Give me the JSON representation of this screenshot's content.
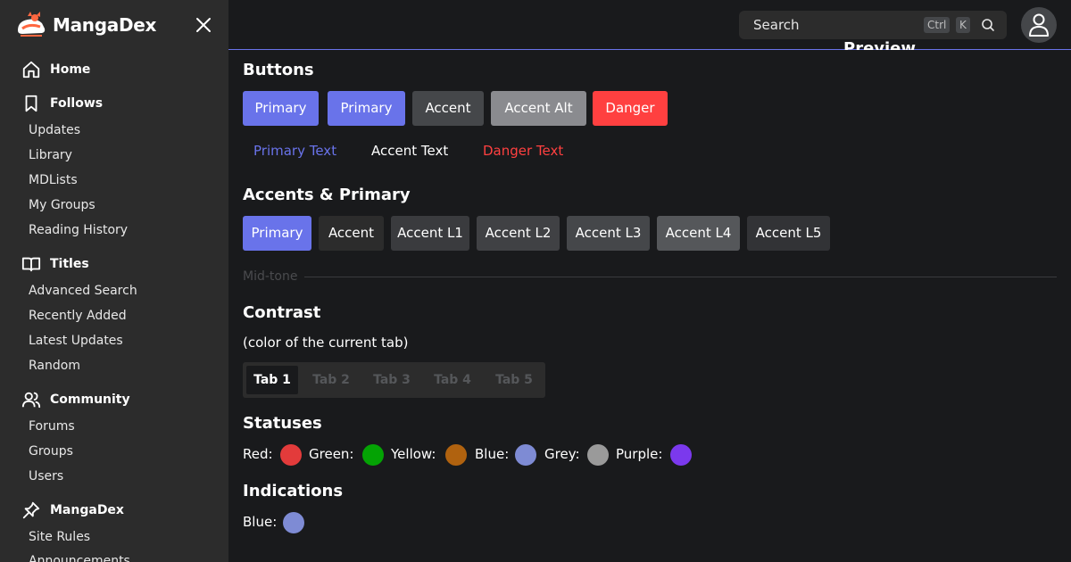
{
  "brand": {
    "name": "MangaDex"
  },
  "sidebar": {
    "sections": [
      {
        "label": "Home",
        "icon": "home-icon"
      },
      {
        "label": "Follows",
        "icon": "bookmark-icon"
      },
      {
        "label": "Titles",
        "icon": "book-open-icon"
      },
      {
        "label": "Community",
        "icon": "users-icon"
      },
      {
        "label": "MangaDex",
        "icon": "pin-icon"
      }
    ],
    "follows_items": [
      "Updates",
      "Library",
      "MDLists",
      "My Groups",
      "Reading History"
    ],
    "titles_items": [
      "Advanced Search",
      "Recently Added",
      "Latest Updates",
      "Random"
    ],
    "community_items": [
      "Forums",
      "Groups",
      "Users"
    ],
    "mangadex_items": [
      "Site Rules",
      "Announcements"
    ]
  },
  "topbar": {
    "search_placeholder": "Search",
    "kbd_ctrl": "Ctrl",
    "kbd_k": "K",
    "preview_label": "Preview"
  },
  "main": {
    "buttons_heading": "Buttons",
    "buttons": [
      {
        "label": "Primary",
        "bg": "#6973ea",
        "color": "#ffffff"
      },
      {
        "label": "Primary",
        "bg": "#6973ea",
        "color": "#ffffff"
      },
      {
        "label": "Accent",
        "bg": "#45474a",
        "color": "#ffffff"
      },
      {
        "label": "Accent Alt",
        "bg": "#8a8b8f",
        "color": "#ffffff"
      },
      {
        "label": "Danger",
        "bg": "#ff4040",
        "color": "#ffffff"
      }
    ],
    "text_buttons": [
      {
        "label": "Primary Text",
        "color": "#6973ea"
      },
      {
        "label": "Accent Text",
        "color": "#ffffff"
      },
      {
        "label": "Danger Text",
        "color": "#ff4040"
      }
    ],
    "accents_heading": "Accents & Primary",
    "accents": [
      {
        "label": "Primary",
        "bg": "#6973ea"
      },
      {
        "label": "Accent",
        "bg": "#2c2c2c"
      },
      {
        "label": "Accent L1",
        "bg": "#3a3b3e"
      },
      {
        "label": "Accent L2",
        "bg": "#404144"
      },
      {
        "label": "Accent L3",
        "bg": "#45474a"
      },
      {
        "label": "Accent L4",
        "bg": "#55575a"
      },
      {
        "label": "Accent L5",
        "bg": "#323336"
      }
    ],
    "midtone_label": "Mid-tone",
    "contrast_heading": "Contrast",
    "contrast_sub": "(color of the current tab)",
    "tabs": [
      "Tab 1",
      "Tab 2",
      "Tab 3",
      "Tab 4",
      "Tab 5"
    ],
    "active_tab": "Tab 1",
    "statuses_heading": "Statuses",
    "statuses": [
      {
        "label": "Red:",
        "color": "#e33b3b"
      },
      {
        "label": "Green:",
        "color": "#04a304"
      },
      {
        "label": "Yellow:",
        "color": "#b0620f"
      },
      {
        "label": "Blue:",
        "color": "#7e8bd4"
      },
      {
        "label": "Grey:",
        "color": "#9a9a9a"
      },
      {
        "label": "Purple:",
        "color": "#7b39ed"
      }
    ],
    "indications_heading": "Indications",
    "indications": [
      {
        "label": "Blue:",
        "color": "#7e8bd4"
      }
    ]
  },
  "colors": {
    "accent": "#6973ea",
    "danger": "#ff4040",
    "background": "#191a1c",
    "sidebar": "#2c2c2c"
  }
}
